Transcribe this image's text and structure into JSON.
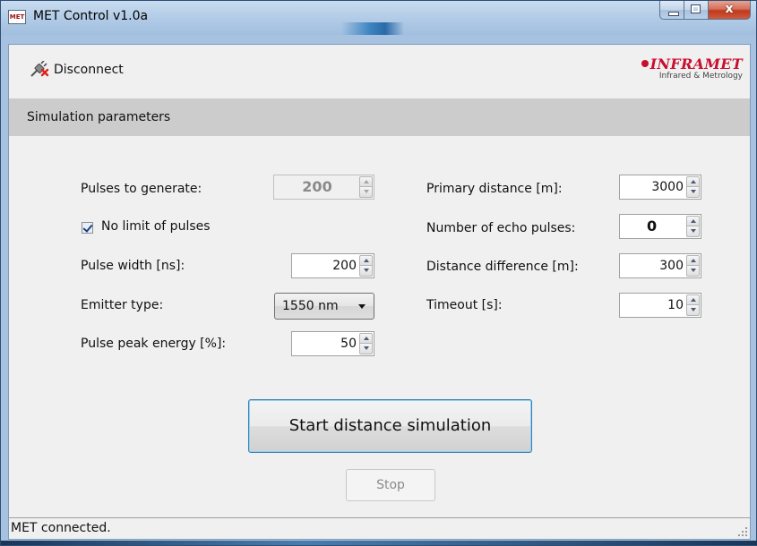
{
  "window": {
    "title": "MET Control v1.0a",
    "app_icon_text": "MET",
    "close_glyph": "x"
  },
  "toolbar": {
    "disconnect_label": "Disconnect",
    "logo_name": "INFRAMET",
    "logo_tagline": "Infrared & Metrology"
  },
  "section": {
    "title": "Simulation parameters"
  },
  "left": {
    "pulses_label": "Pulses to generate:",
    "pulses_value": "200",
    "no_limit_label": "No limit of pulses",
    "no_limit_checked": true,
    "pulse_width_label": "Pulse width [ns]:",
    "pulse_width_value": "200",
    "emitter_label": "Emitter type:",
    "emitter_value": "1550 nm",
    "peak_energy_label": "Pulse peak energy [%]:",
    "peak_energy_value": "50"
  },
  "right": {
    "primary_distance_label": "Primary distance [m]:",
    "primary_distance_value": "3000",
    "echo_pulses_label": "Number of echo pulses:",
    "echo_pulses_value": "0",
    "distance_diff_label": "Distance difference [m]:",
    "distance_diff_value": "300",
    "timeout_label": "Timeout [s]:",
    "timeout_value": "10"
  },
  "actions": {
    "start_label": "Start distance simulation",
    "stop_label": "Stop"
  },
  "status": {
    "text": "MET connected."
  },
  "colors": {
    "brand": "#c8102e",
    "section_header": "#cccccc",
    "focus_border": "#3c7fb1"
  }
}
